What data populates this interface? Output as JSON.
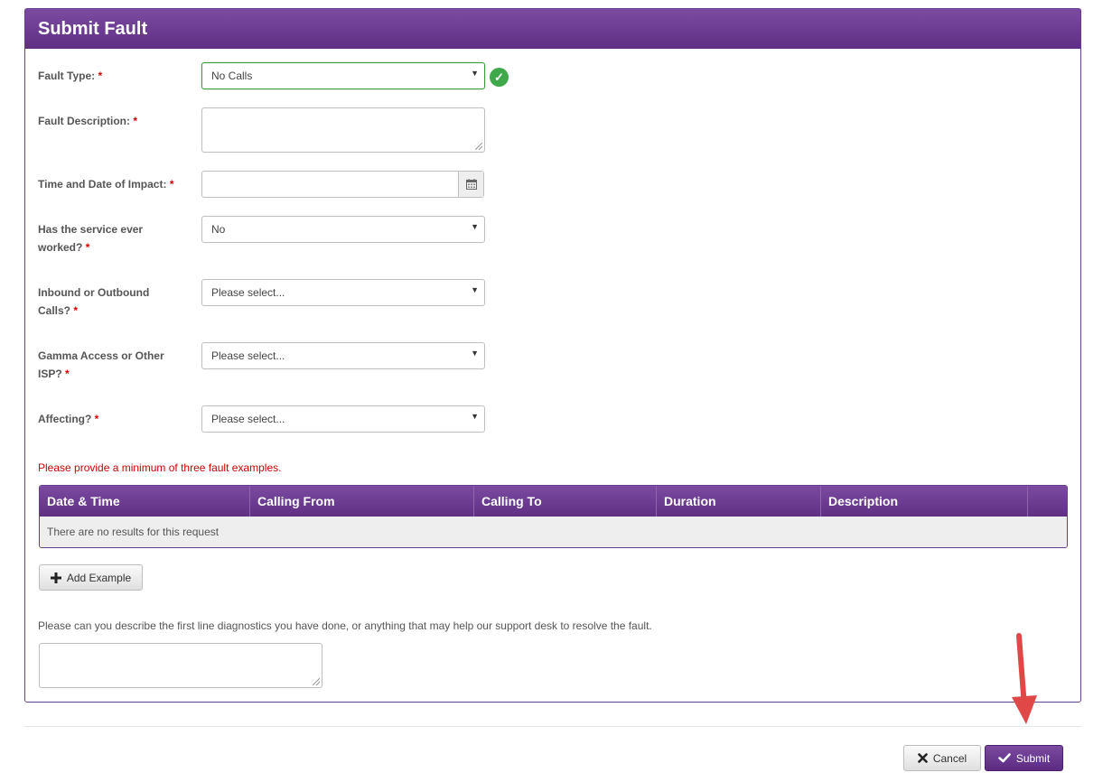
{
  "panel": {
    "title": "Submit Fault"
  },
  "form": {
    "fault_type": {
      "label": "Fault Type:",
      "required": "*",
      "value": "No Calls"
    },
    "fault_description": {
      "label": "Fault Description:",
      "required": "*",
      "value": ""
    },
    "time_date": {
      "label": "Time and Date of Impact:",
      "required": "*",
      "value": ""
    },
    "service_worked": {
      "label_line1": "Has the service ever",
      "label_line2": "worked?",
      "required": "*",
      "value": "No"
    },
    "inbound_outbound": {
      "label_line1": "Inbound or Outbound",
      "label_line2": "Calls?",
      "required": "*",
      "value": "Please select..."
    },
    "gamma_access": {
      "label_line1": "Gamma Access or Other",
      "label_line2": "ISP?",
      "required": "*",
      "value": "Please select..."
    },
    "affecting": {
      "label": "Affecting?",
      "required": "*",
      "value": "Please select..."
    }
  },
  "examples": {
    "warning": "Please provide a minimum of three fault examples.",
    "columns": [
      "Date & Time",
      "Calling From",
      "Calling To",
      "Duration",
      "Description"
    ],
    "empty_message": "There are no results for this request",
    "add_button": "Add Example"
  },
  "diagnostics": {
    "help_text": "Please can you describe the first line diagnostics you have done, or anything that may help our support desk to resolve the fault.",
    "value": ""
  },
  "footer": {
    "cancel_label": "Cancel",
    "submit_label": "Submit"
  },
  "icons": {
    "valid": "check-circle-icon",
    "calendar": "calendar-icon",
    "add": "plus-icon",
    "cancel": "close-icon",
    "submit": "checkmark-icon",
    "annotation": "red-arrow-icon"
  },
  "colors": {
    "brand": "#6a3d8f",
    "required": "#d40000",
    "valid": "#3fa84a",
    "annotation": "#e04848"
  }
}
